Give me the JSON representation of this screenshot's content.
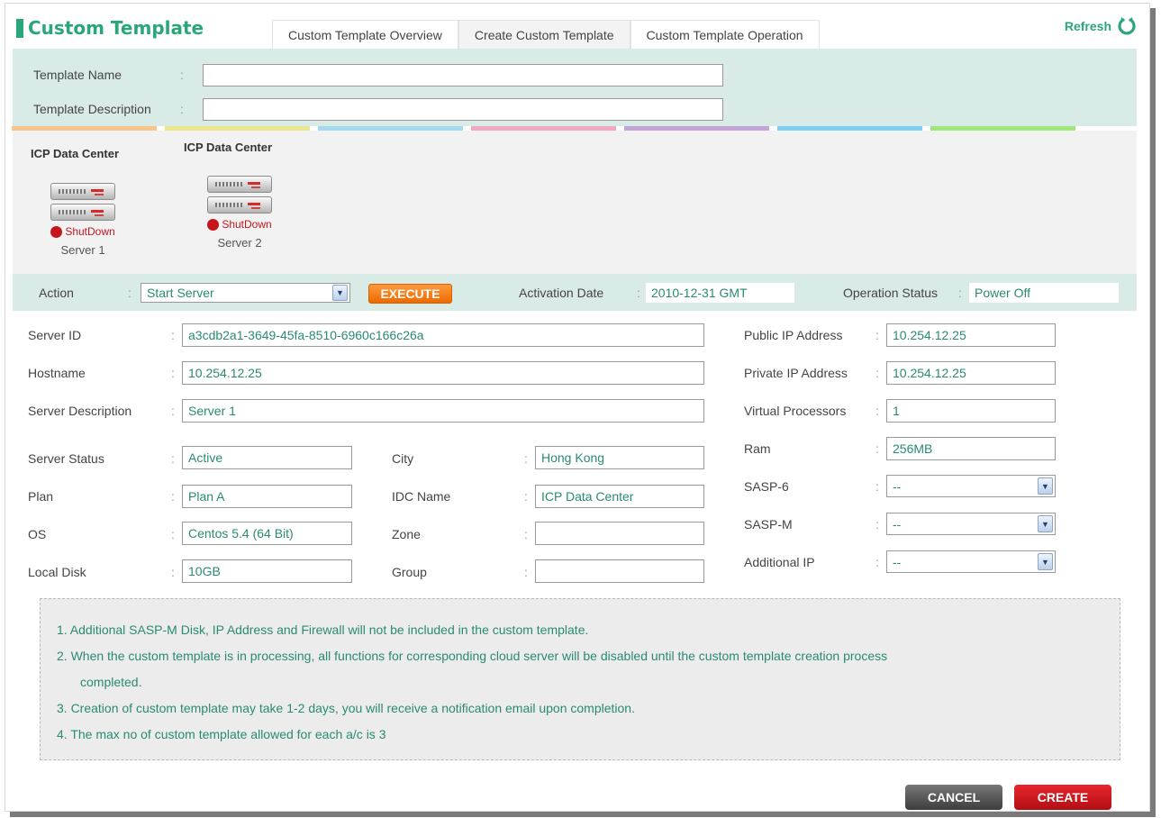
{
  "app": {
    "title": "Custom Template"
  },
  "tabs": [
    {
      "label": "Custom Template Overview",
      "active": false
    },
    {
      "label": "Create Custom Template",
      "active": true
    },
    {
      "label": "Custom Template Operation",
      "active": false
    }
  ],
  "refresh": {
    "label": "Refresh",
    "icon": "refresh-icon"
  },
  "meta": {
    "name_label": "Template Name",
    "desc_label": "Template Description",
    "colon": ":",
    "name_value": "",
    "desc_value": ""
  },
  "strip_colors": [
    "#f9c58a",
    "#ece68c",
    "#a6d8ef",
    "#f2a7c6",
    "#c4a6d6",
    "#7fd0f5",
    "#9fe77b"
  ],
  "data_centers": [
    {
      "name": "ICP Data Center",
      "server": {
        "status": "ShutDown",
        "label": "Server 1"
      }
    },
    {
      "name": "ICP Data Center",
      "server": {
        "status": "ShutDown",
        "label": "Server 2"
      }
    }
  ],
  "action_bar": {
    "action_label": "Action",
    "action_value": "Start Server",
    "execute_label": "EXECUTE",
    "activation_label": "Activation Date",
    "activation_value": "2010-12-31 GMT",
    "op_status_label": "Operation Status",
    "op_status_value": "Power Off"
  },
  "details": {
    "server_id": {
      "label": "Server ID",
      "value": "a3cdb2a1-3649-45fa-8510-6960c166c26a"
    },
    "hostname": {
      "label": "Hostname",
      "value": "10.254.12.25"
    },
    "server_description": {
      "label": "Server Description",
      "value": "Server 1"
    },
    "server_status": {
      "label": "Server Status",
      "value": "Active"
    },
    "plan": {
      "label": "Plan",
      "value": "Plan A"
    },
    "os": {
      "label": "OS",
      "value": "Centos 5.4 (64 Bit)"
    },
    "local_disk": {
      "label": "Local Disk",
      "value": "10GB"
    },
    "city": {
      "label": "City",
      "value": "Hong Kong"
    },
    "idc_name": {
      "label": "IDC Name",
      "value": "ICP Data Center"
    },
    "zone": {
      "label": "Zone",
      "value": ""
    },
    "group": {
      "label": "Group",
      "value": ""
    },
    "public_ip": {
      "label": "Public IP Address",
      "value": "10.254.12.25"
    },
    "private_ip": {
      "label": "Private IP Address",
      "value": "10.254.12.25"
    },
    "virtual_processors": {
      "label": "Virtual Processors",
      "value": "1"
    },
    "ram": {
      "label": "Ram",
      "value": "256MB"
    },
    "sasp6": {
      "label": "SASP-6",
      "value": "--"
    },
    "saspm": {
      "label": "SASP-M",
      "value": "--"
    },
    "additional_ip": {
      "label": "Additional IP",
      "value": "--"
    }
  },
  "notes": [
    "1.  Additional SASP-M Disk, IP Address and Firewall will not be included in the custom template.",
    "2.  When the custom template is in processing, all functions for corresponding cloud server will be disabled until the custom template creation process",
    "completed.",
    "3.  Creation of custom template may take 1-2 days, you will receive a notification email upon completion.",
    "4.  The max no of custom template allowed for each a/c is 3"
  ],
  "footer": {
    "cancel_label": "CANCEL",
    "create_label": "CREATE"
  }
}
